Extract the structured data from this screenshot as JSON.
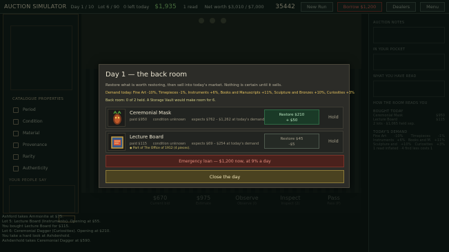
{
  "topbar": {
    "title": "AUCTION SIMULATOR",
    "day": "Day 1 / 10",
    "lot": "Lot 6 / 90",
    "left_today": "0 left today",
    "money": "$1,935",
    "read": "1 read",
    "net_worth": "Net worth $3,010 / $7,000",
    "cash": "35442",
    "buttons": [
      "New Run",
      "Borrow $1,200",
      "Dealers",
      "Menu"
    ]
  },
  "left_panel": {
    "catalogue_heading": "CATALOGUE PROPERTIES",
    "properties": [
      "Period",
      "Condition",
      "Material",
      "Provenance",
      "Rarity",
      "Authenticity"
    ],
    "people_heading": "YOUR PEOPLE SAY"
  },
  "stats": [
    {
      "value": "$670",
      "label": "Current bid"
    },
    {
      "value": "$975",
      "label": "Estimate"
    },
    {
      "value": "Observe",
      "label": "Observe (I)"
    },
    {
      "value": "Inspect",
      "label": "Inspect (2)"
    },
    {
      "value": "Pass",
      "label": "Pass (P)"
    }
  ],
  "log": [
    "Ashford takes Ammonite at $75.",
    "Lot 5: Lecture Board (Instruments). Opening at $55.",
    "You bought Lecture Board for $115.",
    "Lot 6: Ceremonial Dagger (Curiosities). Opening at $210.",
    "You take a hard look at Ashdenhold.",
    "Ashdenhold takes Ceremonial Dagger at $590."
  ],
  "right_panel": {
    "sections": [
      "AUCTION NOTES",
      "IN YOUR POCKET",
      "WHAT YOU HAVE READ",
      "HOW THE ROOM READS YOU",
      "BOUGHT TODAY",
      "TODAY'S DEMAND"
    ],
    "bought": [
      {
        "name": "Ceremonial Mask",
        "price": "$950"
      },
      {
        "name": "Lecture Board",
        "price": "$115"
      }
    ],
    "bought_total": "2 lots · $1,065 held sep.",
    "demand": [
      [
        "Fine Art",
        "-10%",
        "Timepieces",
        "-1%"
      ],
      [
        "Instruments",
        "+6%",
        "Books and M.",
        "+11%"
      ],
      [
        "Sculpture and",
        "+10%",
        "Curiosities",
        "+3%"
      ]
    ],
    "footer": "1 read inflated · 4 find less costs 1"
  },
  "modal": {
    "title": "Day 1 — the back room",
    "description": "Restore what is worth restoring, then sell into today's market. Nothing is certain until it sells.",
    "demand": "Demand today: Fine Art -10%, Timepieces -1%, Instruments +6%, Books and Manuscripts +11%, Sculpture and Bronzes +10%, Curiosities +3%",
    "room": "Back room: 0 of 2 held.  A Storage Vault would make room for 6.",
    "items": [
      {
        "name": "Ceremonial Mask",
        "paid": "paid $950",
        "condition": "condition unknown",
        "expects": "expects $762 – $1,262 at today's demand",
        "set_note": "",
        "restore_line1": "Restore $210",
        "restore_line2": "+ $50",
        "hold": "Hold"
      },
      {
        "name": "Lecture Board",
        "paid": "paid $115",
        "condition": "condition unknown",
        "expects": "expects $69 – $254 at today's demand",
        "set_note": "◆ Part of The Office of 1912 (4 pieces).",
        "restore_line1": "Restore $45",
        "restore_line2": "-$5",
        "hold": "Hold"
      }
    ],
    "loan_button": "Emergency loan — $1,200 now, at 9% a day",
    "close_button": "Close the day"
  }
}
